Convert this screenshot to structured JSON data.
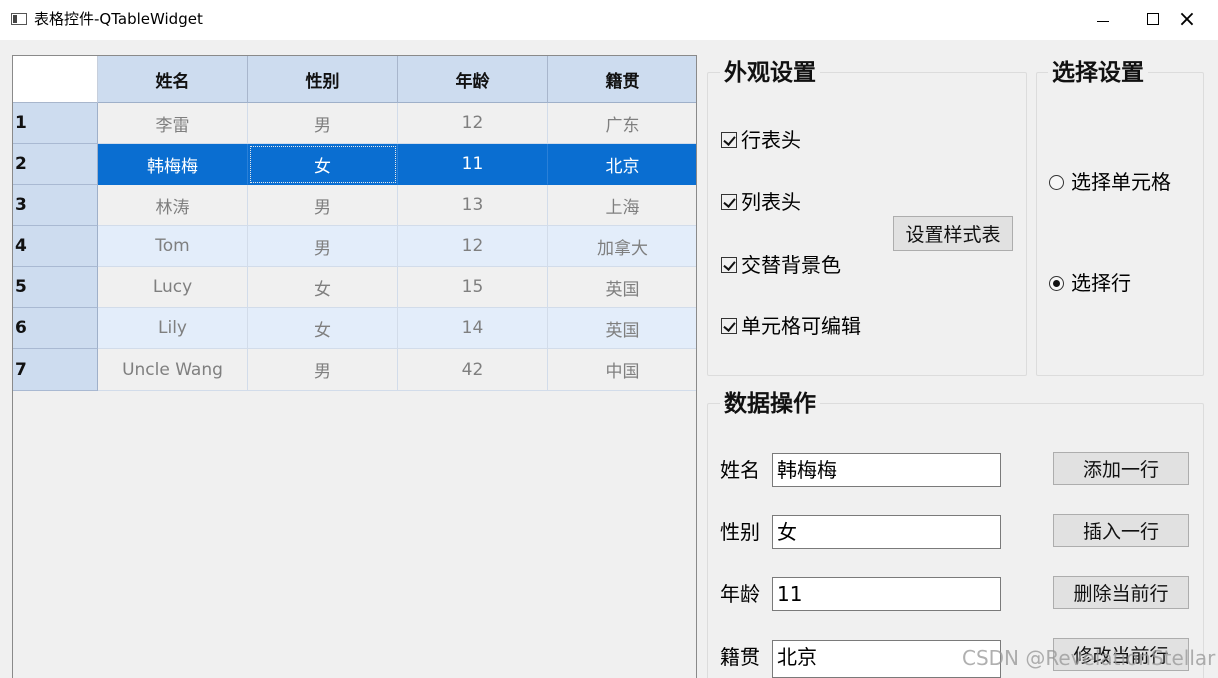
{
  "window": {
    "title": "表格控件-QTableWidget",
    "controls": {
      "minimize": "minimize-icon",
      "maximize": "maximize-icon",
      "close": "×"
    }
  },
  "table": {
    "columns": [
      "姓名",
      "性别",
      "年龄",
      "籍贯"
    ],
    "rows": [
      {
        "header": "1",
        "cells": [
          "李雷",
          "男",
          "12",
          "广东"
        ]
      },
      {
        "header": "2",
        "cells": [
          "韩梅梅",
          "女",
          "11",
          "北京"
        ]
      },
      {
        "header": "3",
        "cells": [
          "林涛",
          "男",
          "13",
          "上海"
        ]
      },
      {
        "header": "4",
        "cells": [
          "Tom",
          "男",
          "12",
          "加拿大"
        ]
      },
      {
        "header": "5",
        "cells": [
          "Lucy",
          "女",
          "15",
          "英国"
        ]
      },
      {
        "header": "6",
        "cells": [
          "Lily",
          "女",
          "14",
          "英国"
        ]
      },
      {
        "header": "7",
        "cells": [
          "Uncle Wang",
          "男",
          "42",
          "中国"
        ]
      }
    ],
    "selected_row": 2,
    "colors": {
      "selection": "#0a6ed1",
      "header": "#cddcef",
      "alternate": "#e3edfa"
    }
  },
  "appearance": {
    "title": "外观设置",
    "options": [
      {
        "label": "行表头",
        "checked": true
      },
      {
        "label": "列表头",
        "checked": true
      },
      {
        "label": "交替背景色",
        "checked": true
      },
      {
        "label": "单元格可编辑",
        "checked": true
      }
    ],
    "stylesheet_button": "设置样式表"
  },
  "selection": {
    "title": "选择设置",
    "options": [
      {
        "label": "选择单元格",
        "checked": false
      },
      {
        "label": "选择行",
        "checked": true
      }
    ]
  },
  "data_ops": {
    "title": "数据操作",
    "fields": [
      {
        "label": "姓名",
        "value": "韩梅梅"
      },
      {
        "label": "性别",
        "value": "女"
      },
      {
        "label": "年龄",
        "value": "11"
      },
      {
        "label": "籍贯",
        "value": "北京"
      }
    ],
    "buttons": [
      "添加一行",
      "插入一行",
      "删除当前行",
      "修改当前行"
    ]
  },
  "watermark": "CSDN @RevelationStellar"
}
